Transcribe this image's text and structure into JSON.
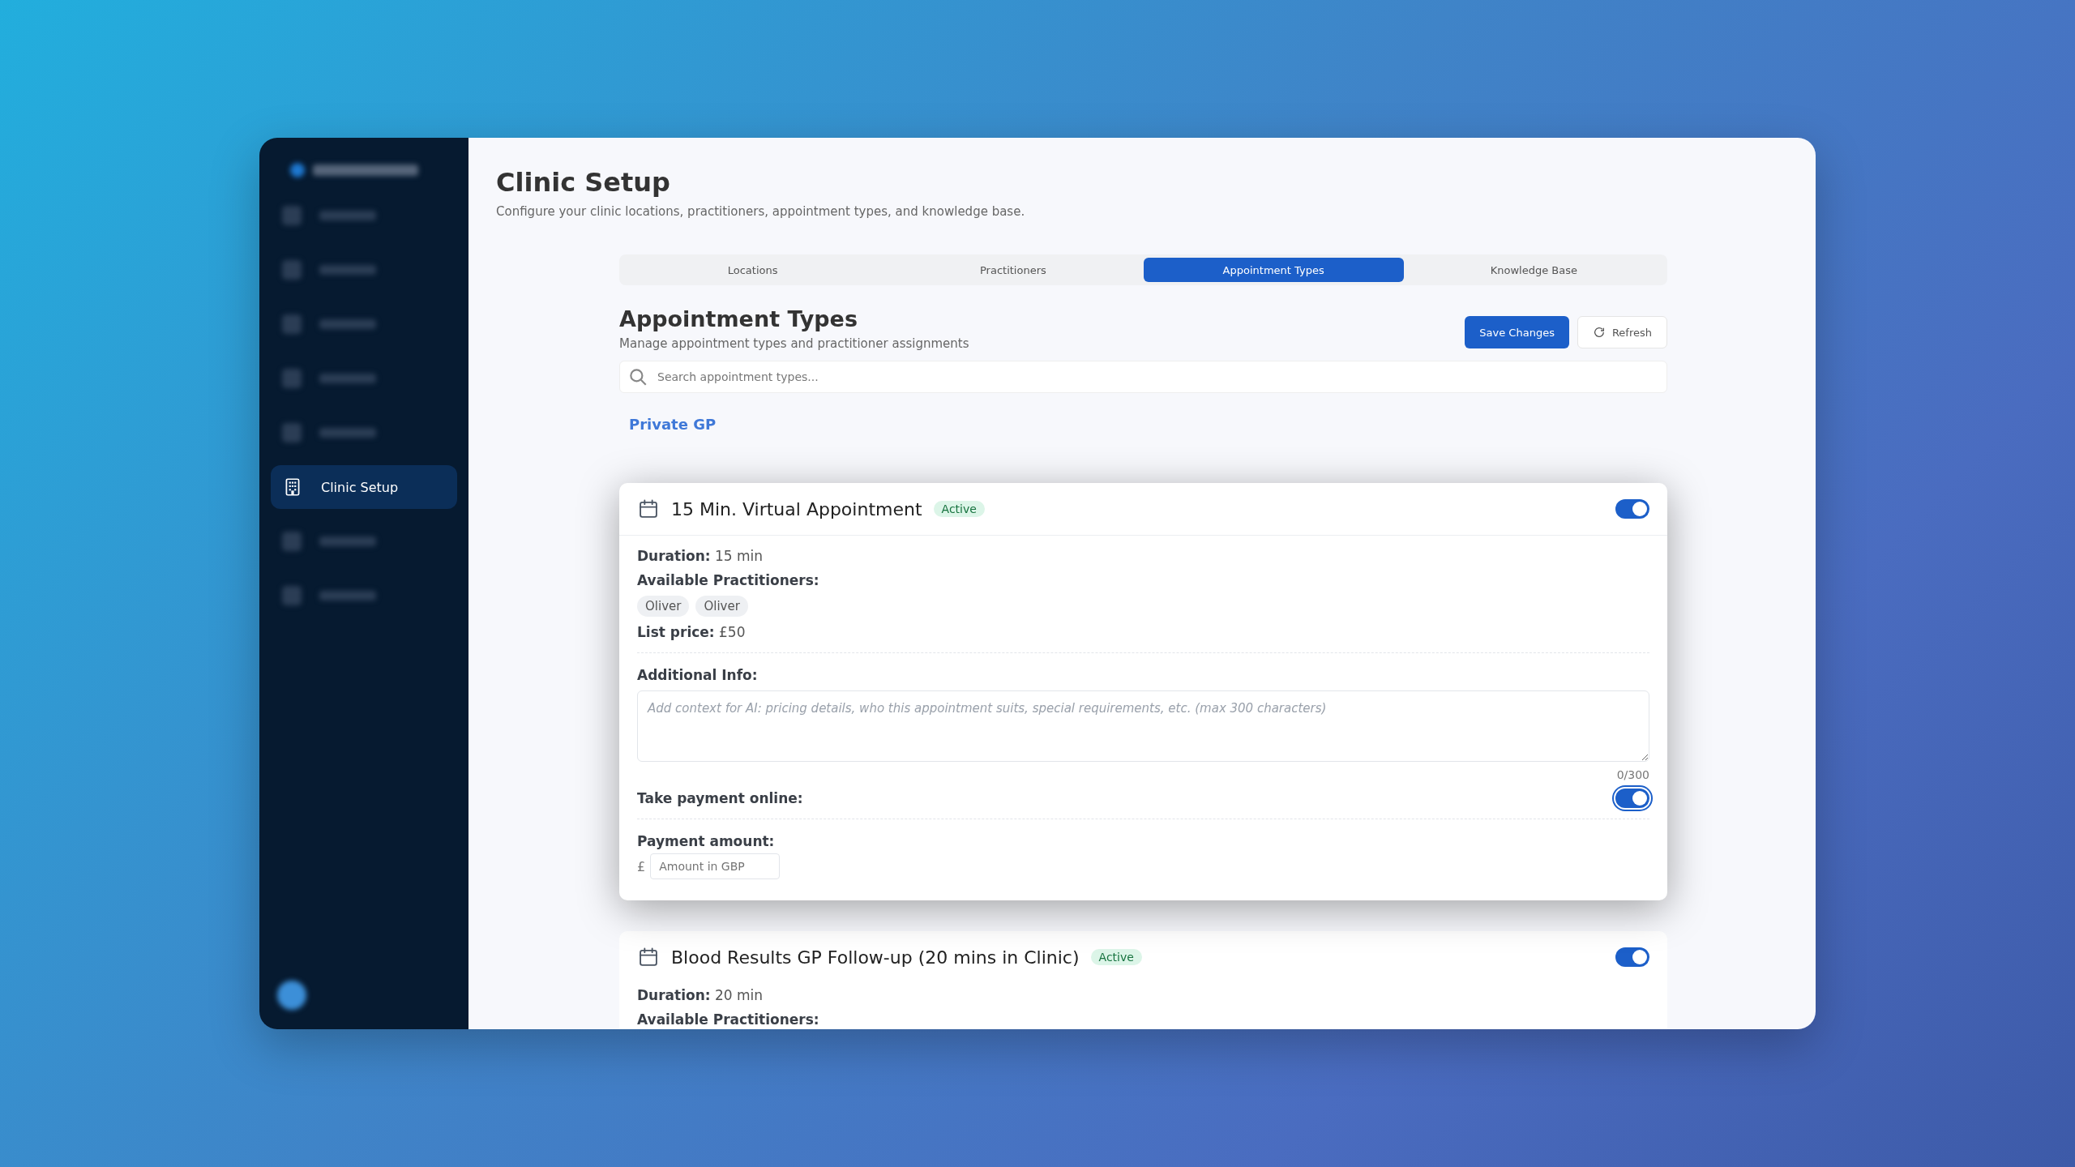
{
  "sidebar": {
    "items": [
      {
        "selected": false
      },
      {
        "selected": false
      },
      {
        "selected": false
      },
      {
        "selected": false
      },
      {
        "selected": false
      },
      {
        "label": "Clinic Setup",
        "selected": true
      },
      {
        "selected": false
      },
      {
        "selected": false
      }
    ]
  },
  "page": {
    "title": "Clinic Setup",
    "subtitle": "Configure your clinic locations, practitioners, appointment types, and knowledge base.",
    "tabs": [
      {
        "label": "Locations",
        "selected": false
      },
      {
        "label": "Practitioners",
        "selected": false
      },
      {
        "label": "Appointment Types",
        "selected": true
      },
      {
        "label": "Knowledge Base",
        "selected": false
      }
    ],
    "section_title": "Appointment Types",
    "section_subtitle": "Manage appointment types and practitioner assignments",
    "buttons": [
      {
        "label": "Save Changes",
        "kind": "primary"
      },
      {
        "label": "Refresh",
        "kind": "secondary"
      }
    ],
    "search": {
      "placeholder": "Search appointment types..."
    },
    "group": "Private GP"
  },
  "focused_card": {
    "title": "15 Min. Virtual Appointment",
    "status": "Active",
    "enabled": true,
    "duration": "**Duration:** 15 min",
    "practitioners_label": "Available Practitioners:",
    "practitioners": [
      "Oliver",
      "Oliver"
    ],
    "list_price": "**List price:** £50",
    "additional_info_label": "Additional Info:",
    "additional_info": {
      "placeholder": "Add context for AI: pricing details, who this appointment suits, special requirements, etc. (max 300 characters)"
    },
    "counter": "0/300",
    "take_payment_label": "Take payment online:",
    "take_payment_online": true,
    "payment_amount_label": "Payment amount:",
    "currency": "£",
    "amount": {
      "placeholder": "Amount in GBP"
    }
  },
  "next_card": {
    "title": "Blood Results GP Follow-up (20 mins in Clinic)",
    "status": "Active",
    "enabled": true,
    "duration": "**Duration:** 20 min",
    "practitioners_label": "Available Practitioners:"
  }
}
